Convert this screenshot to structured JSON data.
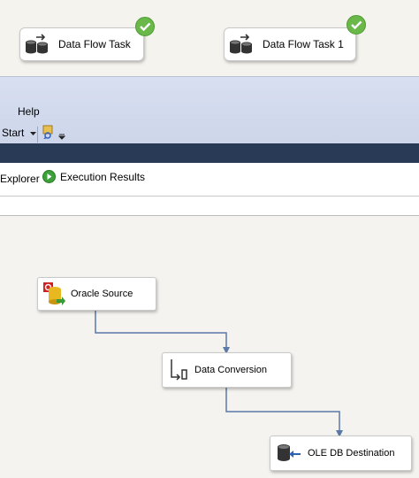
{
  "control_flow": {
    "tasks": [
      {
        "label": "Data Flow Task",
        "icon": "data-flow-task-icon",
        "status": "success-check-icon"
      },
      {
        "label": "Data Flow Task 1",
        "icon": "data-flow-task-icon",
        "status": "success-check-icon"
      }
    ]
  },
  "menu": {
    "help_label": "Help"
  },
  "toolbar": {
    "start_label": "Start",
    "start_dropdown_icon": "dropdown-arrow-icon",
    "find_icon": "find-icon",
    "overflow_icon": "toolbar-overflow-icon"
  },
  "tabs": {
    "explorer_label": "Explorer",
    "execution_results_label": "Execution Results"
  },
  "data_flow": {
    "components": [
      {
        "label": "Oracle Source",
        "icon": "oracle-source-icon"
      },
      {
        "label": "Data Conversion",
        "icon": "data-conversion-icon"
      },
      {
        "label": "OLE DB Destination",
        "icon": "ole-db-destination-icon"
      }
    ]
  },
  "colors": {
    "success": "#6ab84a",
    "connector": "#5a78a8",
    "dark_band": "#293a56",
    "ribbon": "#d2daed"
  }
}
